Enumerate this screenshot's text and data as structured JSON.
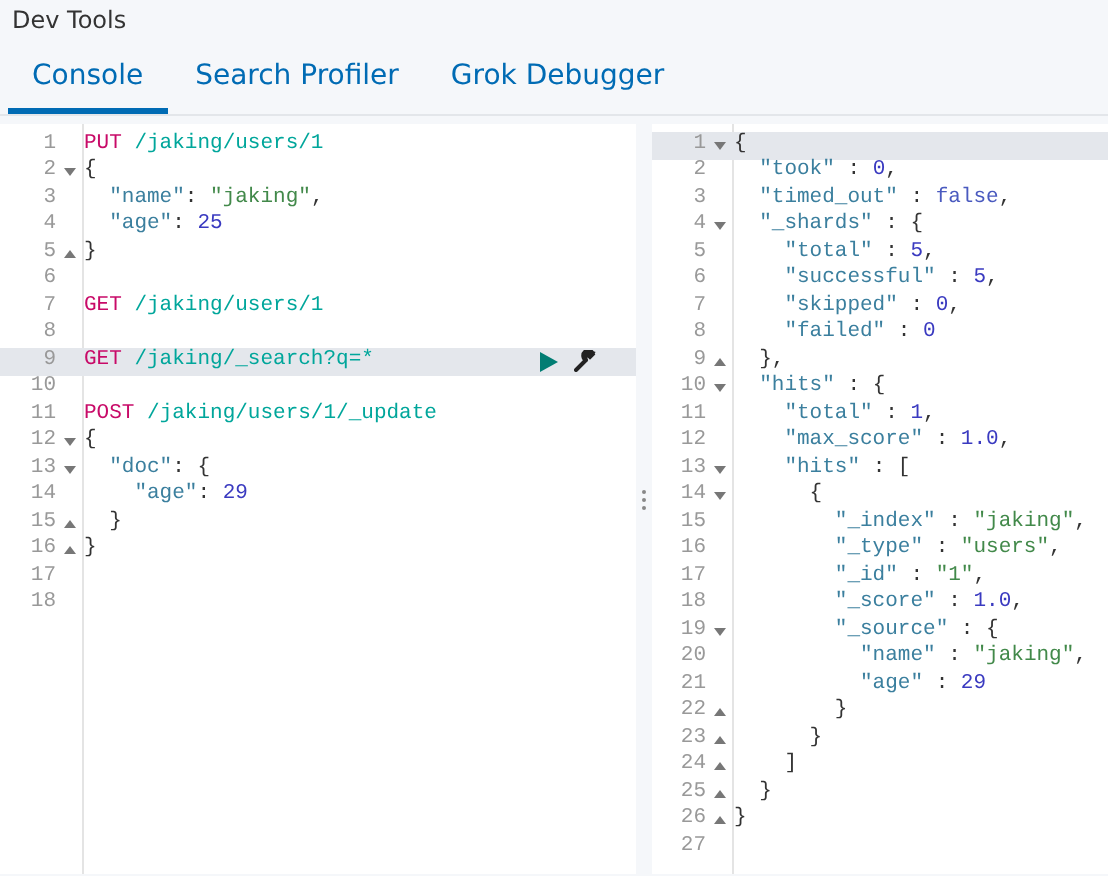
{
  "app_title": "Dev Tools",
  "tabs": [
    {
      "label": "Console",
      "selected": true
    },
    {
      "label": "Search Profiler",
      "selected": false
    },
    {
      "label": "Grok Debugger",
      "selected": false
    }
  ],
  "request_editor": {
    "lines": [
      {
        "n": "1",
        "fold_open": false,
        "fold_close": false,
        "active": false,
        "tokens": [
          {
            "kind": "method",
            "text": "PUT"
          },
          {
            "kind": "url",
            "text": " /jaking/users/1"
          }
        ]
      },
      {
        "n": "2",
        "fold_open": true,
        "fold_close": false,
        "active": false,
        "tokens": [
          {
            "kind": "punct",
            "text": "{"
          }
        ]
      },
      {
        "n": "3",
        "fold_open": false,
        "fold_close": false,
        "active": false,
        "tokens": [
          {
            "kind": "key",
            "text": "  \"name\""
          },
          {
            "kind": "punct",
            "text": ": "
          },
          {
            "kind": "string",
            "text": "\"jaking\""
          },
          {
            "kind": "punct",
            "text": ","
          }
        ]
      },
      {
        "n": "4",
        "fold_open": false,
        "fold_close": false,
        "active": false,
        "tokens": [
          {
            "kind": "key",
            "text": "  \"age\""
          },
          {
            "kind": "punct",
            "text": ": "
          },
          {
            "kind": "number",
            "text": "25"
          }
        ]
      },
      {
        "n": "5",
        "fold_open": false,
        "fold_close": true,
        "active": false,
        "tokens": [
          {
            "kind": "punct",
            "text": "}"
          }
        ]
      },
      {
        "n": "6",
        "fold_open": false,
        "fold_close": false,
        "active": false
      },
      {
        "n": "7",
        "fold_open": false,
        "fold_close": false,
        "active": false,
        "tokens": [
          {
            "kind": "method",
            "text": "GET"
          },
          {
            "kind": "url",
            "text": " /jaking/users/1"
          }
        ]
      },
      {
        "n": "8",
        "fold_open": false,
        "fold_close": false,
        "active": false
      },
      {
        "n": "9",
        "fold_open": false,
        "fold_close": false,
        "active": true,
        "tokens": [
          {
            "kind": "method",
            "text": "GET"
          },
          {
            "kind": "url",
            "text": " /jaking/_search?q=*"
          }
        ]
      },
      {
        "n": "10",
        "fold_open": false,
        "fold_close": false,
        "active": false
      },
      {
        "n": "11",
        "fold_open": false,
        "fold_close": false,
        "active": false,
        "tokens": [
          {
            "kind": "method",
            "text": "POST"
          },
          {
            "kind": "url",
            "text": " /jaking/users/1/_update"
          }
        ]
      },
      {
        "n": "12",
        "fold_open": true,
        "fold_close": false,
        "active": false,
        "tokens": [
          {
            "kind": "punct",
            "text": "{"
          }
        ]
      },
      {
        "n": "13",
        "fold_open": true,
        "fold_close": false,
        "active": false,
        "tokens": [
          {
            "kind": "key",
            "text": "  \"doc\""
          },
          {
            "kind": "punct",
            "text": ": {"
          }
        ]
      },
      {
        "n": "14",
        "fold_open": false,
        "fold_close": false,
        "active": false,
        "tokens": [
          {
            "kind": "key",
            "text": "    \"age\""
          },
          {
            "kind": "punct",
            "text": ": "
          },
          {
            "kind": "number",
            "text": "29"
          }
        ]
      },
      {
        "n": "15",
        "fold_open": false,
        "fold_close": true,
        "active": false,
        "tokens": [
          {
            "kind": "punct",
            "text": "  }"
          }
        ]
      },
      {
        "n": "16",
        "fold_open": false,
        "fold_close": true,
        "active": false,
        "tokens": [
          {
            "kind": "punct",
            "text": "}"
          }
        ]
      },
      {
        "n": "17",
        "fold_open": false,
        "fold_close": false,
        "active": false
      },
      {
        "n": "18",
        "fold_open": false,
        "fold_close": false,
        "active": false
      }
    ]
  },
  "response_editor": {
    "lines": [
      {
        "n": "1",
        "fold_open": true,
        "fold_close": false,
        "active": true,
        "tokens": [
          {
            "kind": "punct",
            "text": "{"
          }
        ]
      },
      {
        "n": "2",
        "fold_open": false,
        "fold_close": false,
        "active": false,
        "tokens": [
          {
            "kind": "key",
            "text": "  \"took\""
          },
          {
            "kind": "punct",
            "text": " : "
          },
          {
            "kind": "number",
            "text": "0"
          },
          {
            "kind": "punct",
            "text": ","
          }
        ]
      },
      {
        "n": "3",
        "fold_open": false,
        "fold_close": false,
        "active": false,
        "tokens": [
          {
            "kind": "key",
            "text": "  \"timed_out\""
          },
          {
            "kind": "punct",
            "text": " : "
          },
          {
            "kind": "keyword",
            "text": "false"
          },
          {
            "kind": "punct",
            "text": ","
          }
        ]
      },
      {
        "n": "4",
        "fold_open": true,
        "fold_close": false,
        "active": false,
        "tokens": [
          {
            "kind": "key",
            "text": "  \"_shards\""
          },
          {
            "kind": "punct",
            "text": " : {"
          }
        ]
      },
      {
        "n": "5",
        "fold_open": false,
        "fold_close": false,
        "active": false,
        "tokens": [
          {
            "kind": "key",
            "text": "    \"total\""
          },
          {
            "kind": "punct",
            "text": " : "
          },
          {
            "kind": "number",
            "text": "5"
          },
          {
            "kind": "punct",
            "text": ","
          }
        ]
      },
      {
        "n": "6",
        "fold_open": false,
        "fold_close": false,
        "active": false,
        "tokens": [
          {
            "kind": "key",
            "text": "    \"successful\""
          },
          {
            "kind": "punct",
            "text": " : "
          },
          {
            "kind": "number",
            "text": "5"
          },
          {
            "kind": "punct",
            "text": ","
          }
        ]
      },
      {
        "n": "7",
        "fold_open": false,
        "fold_close": false,
        "active": false,
        "tokens": [
          {
            "kind": "key",
            "text": "    \"skipped\""
          },
          {
            "kind": "punct",
            "text": " : "
          },
          {
            "kind": "number",
            "text": "0"
          },
          {
            "kind": "punct",
            "text": ","
          }
        ]
      },
      {
        "n": "8",
        "fold_open": false,
        "fold_close": false,
        "active": false,
        "tokens": [
          {
            "kind": "key",
            "text": "    \"failed\""
          },
          {
            "kind": "punct",
            "text": " : "
          },
          {
            "kind": "number",
            "text": "0"
          }
        ]
      },
      {
        "n": "9",
        "fold_open": false,
        "fold_close": true,
        "active": false,
        "tokens": [
          {
            "kind": "punct",
            "text": "  },"
          }
        ]
      },
      {
        "n": "10",
        "fold_open": true,
        "fold_close": false,
        "active": false,
        "tokens": [
          {
            "kind": "key",
            "text": "  \"hits\""
          },
          {
            "kind": "punct",
            "text": " : {"
          }
        ]
      },
      {
        "n": "11",
        "fold_open": false,
        "fold_close": false,
        "active": false,
        "tokens": [
          {
            "kind": "key",
            "text": "    \"total\""
          },
          {
            "kind": "punct",
            "text": " : "
          },
          {
            "kind": "number",
            "text": "1"
          },
          {
            "kind": "punct",
            "text": ","
          }
        ]
      },
      {
        "n": "12",
        "fold_open": false,
        "fold_close": false,
        "active": false,
        "tokens": [
          {
            "kind": "key",
            "text": "    \"max_score\""
          },
          {
            "kind": "punct",
            "text": " : "
          },
          {
            "kind": "number",
            "text": "1.0"
          },
          {
            "kind": "punct",
            "text": ","
          }
        ]
      },
      {
        "n": "13",
        "fold_open": true,
        "fold_close": false,
        "active": false,
        "tokens": [
          {
            "kind": "key",
            "text": "    \"hits\""
          },
          {
            "kind": "punct",
            "text": " : ["
          }
        ]
      },
      {
        "n": "14",
        "fold_open": true,
        "fold_close": false,
        "active": false,
        "tokens": [
          {
            "kind": "punct",
            "text": "      {"
          }
        ]
      },
      {
        "n": "15",
        "fold_open": false,
        "fold_close": false,
        "active": false,
        "tokens": [
          {
            "kind": "key",
            "text": "        \"_index\""
          },
          {
            "kind": "punct",
            "text": " : "
          },
          {
            "kind": "string",
            "text": "\"jaking\""
          },
          {
            "kind": "punct",
            "text": ","
          }
        ]
      },
      {
        "n": "16",
        "fold_open": false,
        "fold_close": false,
        "active": false,
        "tokens": [
          {
            "kind": "key",
            "text": "        \"_type\""
          },
          {
            "kind": "punct",
            "text": " : "
          },
          {
            "kind": "string",
            "text": "\"users\""
          },
          {
            "kind": "punct",
            "text": ","
          }
        ]
      },
      {
        "n": "17",
        "fold_open": false,
        "fold_close": false,
        "active": false,
        "tokens": [
          {
            "kind": "key",
            "text": "        \"_id\""
          },
          {
            "kind": "punct",
            "text": " : "
          },
          {
            "kind": "string",
            "text": "\"1\""
          },
          {
            "kind": "punct",
            "text": ","
          }
        ]
      },
      {
        "n": "18",
        "fold_open": false,
        "fold_close": false,
        "active": false,
        "tokens": [
          {
            "kind": "key",
            "text": "        \"_score\""
          },
          {
            "kind": "punct",
            "text": " : "
          },
          {
            "kind": "number",
            "text": "1.0"
          },
          {
            "kind": "punct",
            "text": ","
          }
        ]
      },
      {
        "n": "19",
        "fold_open": true,
        "fold_close": false,
        "active": false,
        "tokens": [
          {
            "kind": "key",
            "text": "        \"_source\""
          },
          {
            "kind": "punct",
            "text": " : {"
          }
        ]
      },
      {
        "n": "20",
        "fold_open": false,
        "fold_close": false,
        "active": false,
        "tokens": [
          {
            "kind": "key",
            "text": "          \"name\""
          },
          {
            "kind": "punct",
            "text": " : "
          },
          {
            "kind": "string",
            "text": "\"jaking\""
          },
          {
            "kind": "punct",
            "text": ","
          }
        ]
      },
      {
        "n": "21",
        "fold_open": false,
        "fold_close": false,
        "active": false,
        "tokens": [
          {
            "kind": "key",
            "text": "          \"age\""
          },
          {
            "kind": "punct",
            "text": " : "
          },
          {
            "kind": "number",
            "text": "29"
          }
        ]
      },
      {
        "n": "22",
        "fold_open": false,
        "fold_close": true,
        "active": false,
        "tokens": [
          {
            "kind": "punct",
            "text": "        }"
          }
        ]
      },
      {
        "n": "23",
        "fold_open": false,
        "fold_close": true,
        "active": false,
        "tokens": [
          {
            "kind": "punct",
            "text": "      }"
          }
        ]
      },
      {
        "n": "24",
        "fold_open": false,
        "fold_close": true,
        "active": false,
        "tokens": [
          {
            "kind": "punct",
            "text": "    ]"
          }
        ]
      },
      {
        "n": "25",
        "fold_open": false,
        "fold_close": true,
        "active": false,
        "tokens": [
          {
            "kind": "punct",
            "text": "  }"
          }
        ]
      },
      {
        "n": "26",
        "fold_open": false,
        "fold_close": true,
        "active": false,
        "tokens": [
          {
            "kind": "punct",
            "text": "}"
          }
        ]
      },
      {
        "n": "27",
        "fold_open": false,
        "fold_close": false,
        "active": false
      }
    ]
  }
}
